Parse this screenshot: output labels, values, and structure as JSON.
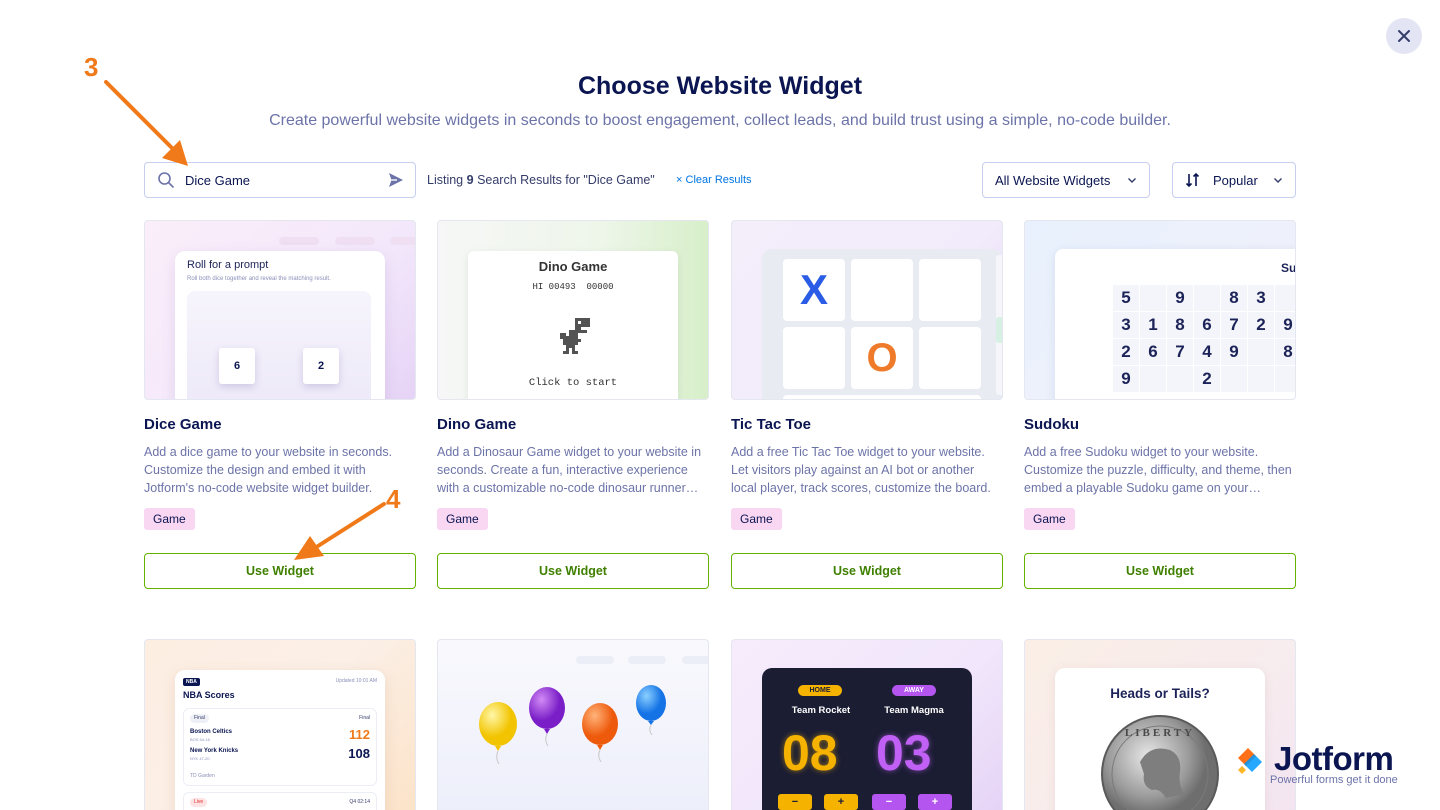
{
  "header": {
    "title": "Choose Website Widget",
    "subtitle": "Create powerful website widgets in seconds to boost engagement, collect leads, and build trust using a simple, no-code builder."
  },
  "search": {
    "value": "Dice Game",
    "listing_prefix": "Listing",
    "count": "9",
    "listing_suffix": "Search Results for \"Dice Game\"",
    "clear_icon": "×",
    "clear_label": "Clear Results"
  },
  "filters": {
    "type_label": "All Website Widgets",
    "sort_label": "Popular"
  },
  "annotations": {
    "step3": "3",
    "step4": "4"
  },
  "cards": [
    {
      "title": "Dice Game",
      "desc": "Add a dice game to your website in seconds. Customize the design and embed it with Jotform's no-code website widget builder.",
      "tag": "Game",
      "button": "Use Widget"
    },
    {
      "title": "Dino Game",
      "desc": "Add a Dinosaur Game widget to your website in seconds. Create a fun, interactive experience with a customizable no-code dinosaur runner game.",
      "tag": "Game",
      "button": "Use Widget"
    },
    {
      "title": "Tic Tac Toe",
      "desc": "Add a free Tic Tac Toe widget to your website. Let visitors play against an AI bot or another local player, track scores, customize the board.",
      "tag": "Game",
      "button": "Use Widget"
    },
    {
      "title": "Sudoku",
      "desc": "Add a free Sudoku widget to your website. Customize the puzzle, difficulty, and theme, then embed a playable Sudoku game on your website.",
      "tag": "Game",
      "button": "Use Widget"
    }
  ],
  "previews": {
    "dice": {
      "title": "Roll for a prompt",
      "subtitle": "Roll both dice together and reveal the matching result.",
      "die1": "6",
      "die2": "2"
    },
    "dino": {
      "title": "Dino Game",
      "score": "HI 00493  00000",
      "cta": "Click to start"
    },
    "tictactoe": {
      "x": "X",
      "o": "O"
    },
    "sudoku": {
      "label": "Su",
      "rows": [
        [
          "5",
          "",
          "9",
          "",
          "8",
          "3",
          ""
        ],
        [
          "3",
          "1",
          "8",
          "6",
          "7",
          "2",
          "9"
        ],
        [
          "2",
          "6",
          "7",
          "4",
          "9",
          "",
          "8"
        ],
        [
          "9",
          "",
          "",
          "2",
          "",
          "",
          ""
        ]
      ]
    },
    "nba": {
      "badge": "NBA",
      "updated": "Updated 10:01 AM",
      "title": "NBA Scores",
      "status": "Final",
      "status_right": "Final",
      "team1": "Boston Celtics",
      "team1_rec": "BOS 54-16",
      "score1": "112",
      "team2": "New York Knicks",
      "team2_rec": "NYK 47-20",
      "score2": "108",
      "venue": "TD Garden",
      "live": "Live",
      "live_time": "Q4 02:14"
    },
    "score": {
      "home": "HOME",
      "away": "AWAY",
      "team1": "Team Rocket",
      "team2": "Team Magma",
      "s1": "08",
      "s2": "03",
      "minus": "−",
      "plus": "+"
    },
    "coin": {
      "title": "Heads or Tails?",
      "word": "LIBERTY"
    }
  },
  "logo": {
    "word": "Jotform",
    "tagline": "Powerful forms get it done"
  },
  "colors": {
    "accent_green": "#64b200",
    "tag_pink": "#f9d6f2",
    "navy": "#0a1551",
    "annotation_orange": "#f07a1a"
  }
}
